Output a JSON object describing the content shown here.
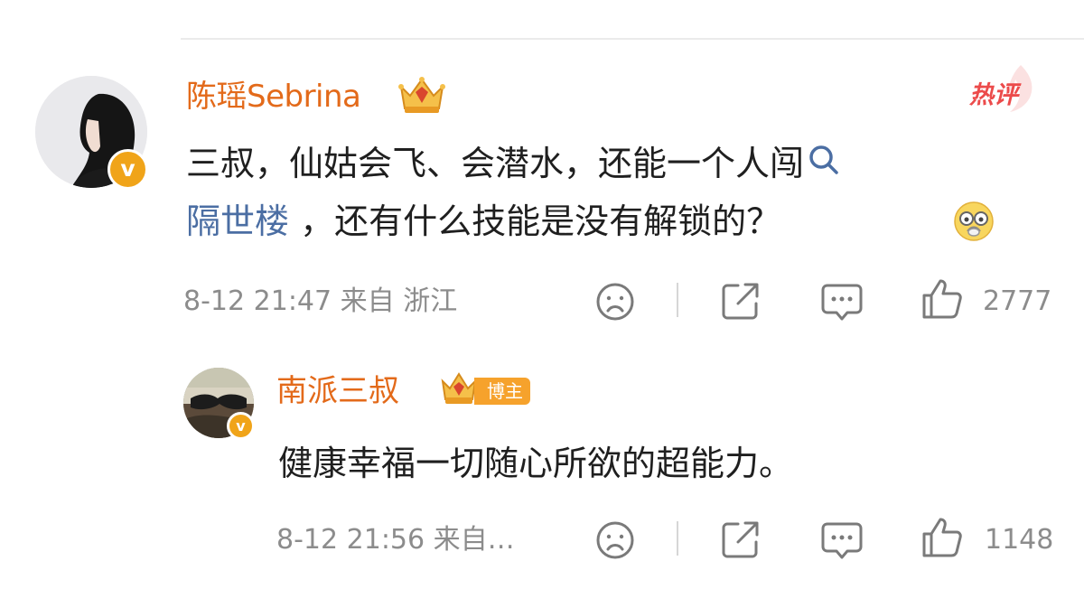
{
  "comment": {
    "username": "陈瑶Sebrina",
    "hot_label": "热评",
    "text_line1": "三叔，仙姑会飞、会潜水，还能一个人闯",
    "link_text": "隔世楼",
    "text_line2_rest": " ，还有什么技能是没有解锁的？",
    "verified_mark": "v",
    "meta": {
      "date": "8-12",
      "time": "21:47",
      "from_label": "来自",
      "location": "浙江"
    },
    "like_count": "2777"
  },
  "reply": {
    "username": "南派三叔",
    "author_tag": "博主",
    "text": "健康幸福一切随心所欲的超能力。",
    "verified_mark": "v",
    "meta": {
      "date": "8-12",
      "time": "21:56",
      "from_label": "来自…"
    },
    "like_count": "1148"
  },
  "icons": {
    "dislike": "sad-face-icon",
    "share": "share-icon",
    "comment": "comment-bubble-icon",
    "like": "thumbs-up-icon",
    "search": "search-icon",
    "emoji": "face-emoji-icon",
    "crown": "crown-icon"
  },
  "colors": {
    "username": "#e36a1a",
    "link": "#4b6ea3",
    "hot": "#ec4b4b",
    "meta": "#8c8c8c",
    "verified": "#f0a419"
  }
}
